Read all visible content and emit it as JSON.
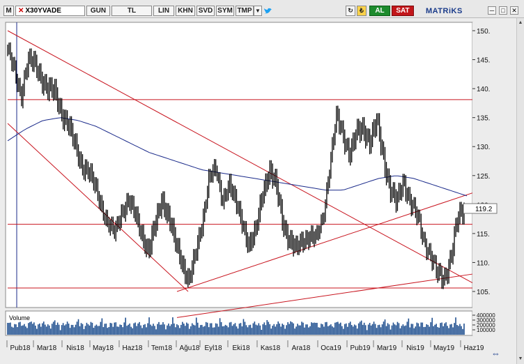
{
  "toolbar": {
    "m_button": "M",
    "close_symbol": "✕",
    "symbol": "X30YVADE",
    "buttons": [
      "GUN",
      "TL",
      "LIN",
      "KHN",
      "SVD",
      "SYM",
      "TMP"
    ],
    "al_label": "AL",
    "sat_label": "SAT",
    "brand": "MATRiKS"
  },
  "chart_data": {
    "type": "line",
    "title": "",
    "xlabel": "",
    "ylabel": "",
    "price_axis": [
      150,
      145,
      140,
      135,
      130,
      125,
      120,
      115,
      110,
      105
    ],
    "ylim": [
      103,
      153
    ],
    "current_price_label": "119.2",
    "x_labels": [
      "Pub18",
      "Mar18",
      "Nis18",
      "May18",
      "Haz18",
      "Tem18",
      "Ağu18",
      "Eyl18",
      "Eki18",
      "Kas18",
      "Ara18",
      "Oca19",
      "Pub19",
      "Mar19",
      "Nis19",
      "May19",
      "Haz19"
    ],
    "series": [
      {
        "name": "",
        "color": "#000000",
        "values": [
          147,
          143,
          139,
          145,
          144,
          142,
          140,
          139,
          136,
          134,
          130,
          127,
          126,
          123,
          120,
          117,
          115,
          119,
          121,
          118,
          115,
          112,
          116,
          121,
          118,
          113,
          110,
          107,
          111,
          117,
          125,
          126,
          121,
          124,
          120,
          117,
          113,
          115,
          122,
          126,
          123,
          117,
          114,
          112,
          114,
          115,
          114,
          118,
          127,
          135,
          132,
          129,
          132,
          133,
          131,
          134,
          128,
          123,
          120,
          124,
          121,
          118,
          114,
          112,
          108,
          107,
          111,
          117,
          119
        ]
      },
      {
        "name": "",
        "color": "#1a2a8a",
        "values": [
          131,
          133,
          134.5,
          135,
          134.5,
          133.5,
          132,
          130.5,
          129,
          128,
          127,
          126,
          125.5,
          125,
          124.5,
          124,
          123.5,
          123,
          122.5,
          122.5,
          123.5,
          124.5,
          125,
          124.5,
          123.5,
          122.5,
          121.5
        ]
      }
    ],
    "trendlines": [
      {
        "name": "",
        "color": "#c8141e",
        "from": [
          "Pub18",
          150
        ],
        "to": [
          "Haz19",
          106.5
        ]
      },
      {
        "name": "",
        "color": "#c8141e",
        "from": [
          "Pub18",
          134
        ],
        "to": [
          "Ağu18",
          105
        ]
      },
      {
        "name": "",
        "color": "#c8141e",
        "from": [
          "Ağu18",
          105
        ],
        "to": [
          "Haz19",
          122
        ]
      },
      {
        "name": "",
        "color": "#c8141e",
        "from": [
          "Ağu18",
          100.5
        ],
        "to": [
          "Haz19",
          108
        ]
      },
      {
        "name": "",
        "color": "#c8141e",
        "from": [
          "Pub18",
          138.1
        ],
        "to": [
          "Haz19",
          138.1
        ]
      },
      {
        "name": "",
        "color": "#c8141e",
        "from": [
          "Pub18",
          116.6
        ],
        "to": [
          "Haz19",
          116.6
        ]
      },
      {
        "name": "",
        "color": "#c8141e",
        "from": [
          "Pub18",
          105.6
        ],
        "to": [
          "Haz19",
          105.6
        ]
      }
    ],
    "volume": {
      "label": "Volume",
      "color": "#1f4f8f",
      "axis_labels": [
        "400000",
        "300000",
        "200000",
        "100000"
      ]
    },
    "grid": false
  }
}
